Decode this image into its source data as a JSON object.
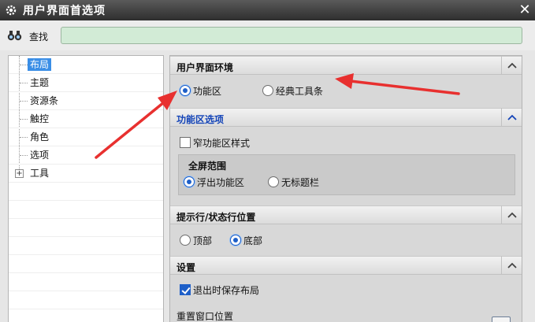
{
  "window": {
    "title": "用户界面首选项"
  },
  "search": {
    "label": "查找",
    "value": ""
  },
  "tree": {
    "items": [
      {
        "label": "布局",
        "selected": true
      },
      {
        "label": "主题"
      },
      {
        "label": "资源条"
      },
      {
        "label": "触控"
      },
      {
        "label": "角色"
      },
      {
        "label": "选项"
      },
      {
        "label": "工具",
        "expander": "+"
      }
    ]
  },
  "sections": {
    "ui_env": {
      "title": "用户界面环境",
      "opt_ribbon": "功能区",
      "opt_classic": "经典工具条"
    },
    "ribbon": {
      "title": "功能区选项",
      "narrow": "窄功能区样式",
      "fullscreen_title": "全屏范围",
      "opt_float": "浮出功能区",
      "opt_notitle": "无标题栏"
    },
    "prompt": {
      "title": "提示行/状态行位置",
      "opt_top": "顶部",
      "opt_bottom": "底部"
    },
    "settings": {
      "title": "设置",
      "save_layout": "退出时保存布局",
      "reset_window": "重置窗口位置"
    }
  },
  "colors": {
    "accent": "#1e5fc8",
    "annotation_arrow": "#e8302f",
    "search_bg": "#d2ebd6"
  }
}
